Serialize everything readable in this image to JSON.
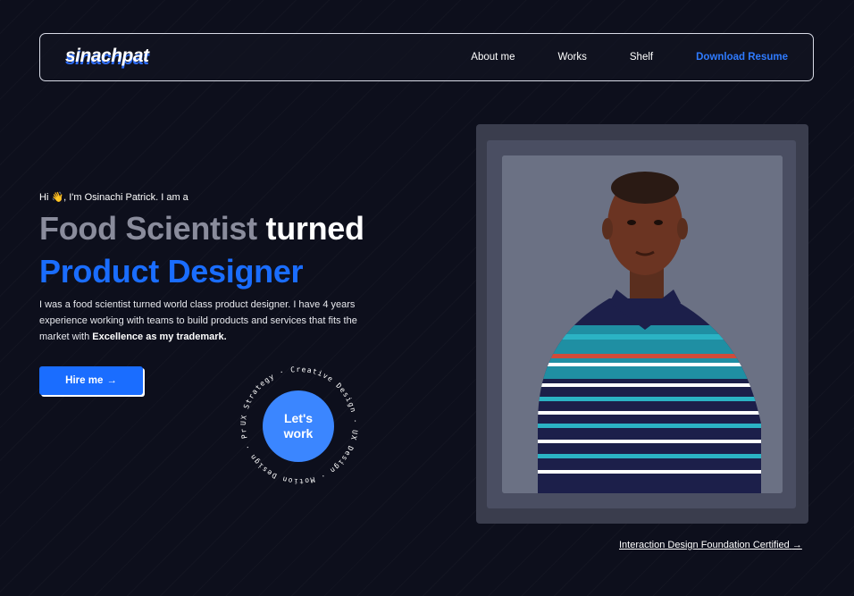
{
  "nav": {
    "logo": "sinachpat",
    "links": [
      {
        "label": "About me"
      },
      {
        "label": "Works"
      },
      {
        "label": "Shelf"
      },
      {
        "label": "Download Resume"
      }
    ]
  },
  "hero": {
    "greeting": "Hi 👋, I'm Osinachi Patrick. I am a",
    "headline_muted": "Food Scientist",
    "headline_white": "turned",
    "headline_blue": "Product Designer",
    "bio_text": "I was a food scientist turned world class product designer. I have 4 years experience working with teams to build products and services that fits the market with ",
    "bio_bold": "Excellence as my trademark.",
    "hire_label": "Hire me",
    "hire_arrow": "→"
  },
  "badge": {
    "ring_text": "UX Strategy · Creative Design · UX Design · Motion Design · Product ·",
    "line1": "Let's",
    "line2": "work"
  },
  "certification": {
    "label": "Interaction Design Foundation Certified",
    "arrow": "→"
  },
  "colors": {
    "background": "#0d0f1c",
    "accent": "#1a6dff",
    "muted_text": "#8a8c9c"
  }
}
